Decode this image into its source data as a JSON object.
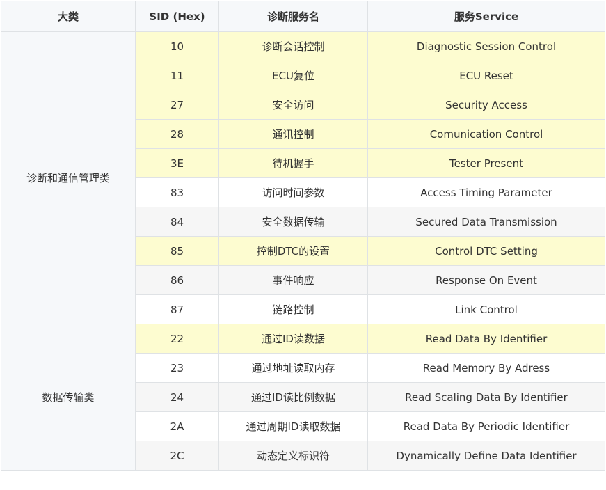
{
  "headers": [
    "大类",
    "SID (Hex)",
    "诊断服务名",
    "服务Service"
  ],
  "colors": {
    "highlight": "#fdfcd0",
    "stripe": "#f6f6f6",
    "header": "#f6f8fa",
    "border": "#dfe2e5"
  },
  "groups": [
    {
      "category": "诊断和通信管理类",
      "rows": [
        {
          "sid": "10",
          "name": "诊断会话控制",
          "service": "Diagnostic Session Control",
          "style": "hl"
        },
        {
          "sid": "11",
          "name": "ECU复位",
          "service": "ECU Reset",
          "style": "hl"
        },
        {
          "sid": "27",
          "name": "安全访问",
          "service": "Security Access",
          "style": "hl"
        },
        {
          "sid": "28",
          "name": "通讯控制",
          "service": "Comunication Control",
          "style": "hl"
        },
        {
          "sid": "3E",
          "name": "待机握手",
          "service": "Tester Present",
          "style": "hl"
        },
        {
          "sid": "83",
          "name": "访问时间参数",
          "service": "Access Timing Parameter",
          "style": "odd"
        },
        {
          "sid": "84",
          "name": "安全数据传输",
          "service": "Secured Data Transmission",
          "style": "even"
        },
        {
          "sid": "85",
          "name": "控制DTC的设置",
          "service": "Control DTC Setting",
          "style": "hl"
        },
        {
          "sid": "86",
          "name": "事件响应",
          "service": "Response On Event",
          "style": "even"
        },
        {
          "sid": "87",
          "name": "链路控制",
          "service": "Link Control",
          "style": "odd"
        }
      ]
    },
    {
      "category": "数据传输类",
      "rows": [
        {
          "sid": "22",
          "name": "通过ID读数据",
          "service": "Read Data By Identifier",
          "style": "hl"
        },
        {
          "sid": "23",
          "name": "通过地址读取内存",
          "service": "Read Memory By Adress",
          "style": "odd"
        },
        {
          "sid": "24",
          "name": "通过ID读比例数据",
          "service": "Read Scaling Data By Identifier",
          "style": "even"
        },
        {
          "sid": "2A",
          "name": "通过周期ID读取数据",
          "service": "Read Data By Periodic Identifier",
          "style": "odd"
        },
        {
          "sid": "2C",
          "name": "动态定义标识符",
          "service": "Dynamically Define Data Identifier",
          "style": "even"
        }
      ]
    }
  ]
}
